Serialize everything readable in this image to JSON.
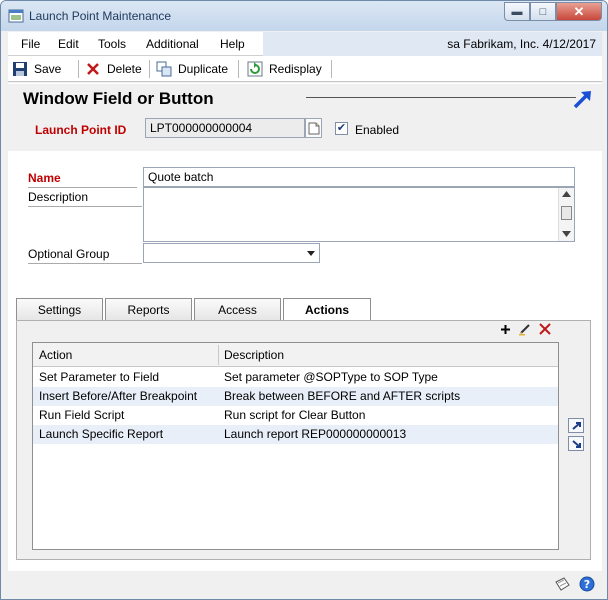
{
  "window": {
    "title": "Launch Point Maintenance"
  },
  "menu": {
    "file": "File",
    "edit": "Edit",
    "tools": "Tools",
    "additional": "Additional",
    "help": "Help",
    "company_info": "sa  Fabrikam, Inc.  4/12/2017"
  },
  "toolbar": {
    "save": "Save",
    "delete": "Delete",
    "duplicate": "Duplicate",
    "redisplay": "Redisplay"
  },
  "form": {
    "title": "Window Field or Button",
    "launch_point_label": "Launch Point  ID",
    "launch_point_value": "LPT000000000004",
    "enabled_label": "Enabled",
    "enabled_checked": true,
    "name_label": "Name",
    "name_value": "Quote batch",
    "description_label": "Description",
    "description_value": "",
    "optional_group_label": "Optional Group",
    "optional_group_value": ""
  },
  "tabs": [
    "Settings",
    "Reports",
    "Access",
    "Actions"
  ],
  "active_tab": "Actions",
  "actions_table": {
    "columns": [
      "Action",
      "Description"
    ],
    "rows": [
      [
        "Set Parameter to Field",
        "Set parameter @SOPType to SOP Type"
      ],
      [
        "Insert Before/After Breakpoint",
        "Break between BEFORE and AFTER scripts"
      ],
      [
        "Run Field Script",
        "Run script for Clear Button"
      ],
      [
        "Launch Specific Report",
        "Launch report REP000000000013"
      ]
    ]
  },
  "colors": {
    "required_label": "#c00000",
    "accent_blue": "#1a4fd6",
    "row_alt": "#e9eff8"
  },
  "icons": [
    "save-icon",
    "delete-icon",
    "duplicate-icon",
    "redisplay-icon",
    "lookup-icon",
    "add-icon",
    "edit-icon",
    "remove-icon",
    "move-up-icon",
    "move-down-icon",
    "note-icon",
    "help-icon",
    "arrow-icon"
  ]
}
